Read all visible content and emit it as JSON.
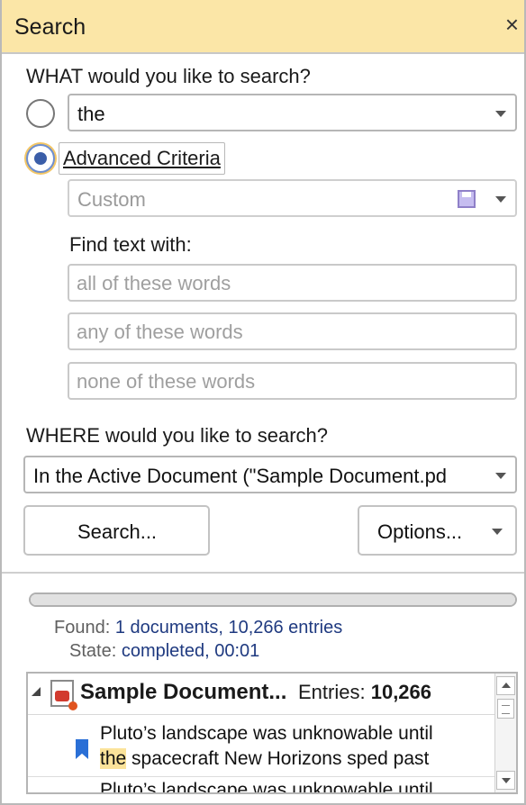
{
  "panel": {
    "title": "Search",
    "close_glyph": "×"
  },
  "what": {
    "label": "WHAT would you like to search?",
    "basic_value": "the",
    "advanced_label": "Advanced Criteria",
    "criteria_value": "Custom",
    "find_text_label": "Find text with:",
    "all_words_placeholder": "all of these words",
    "any_words_placeholder": "any of these words",
    "none_words_placeholder": "none of these words"
  },
  "where": {
    "label": "WHERE would you like to search?",
    "scope_value": "In the Active Document (\"Sample Document.pd"
  },
  "buttons": {
    "search": "Search...",
    "options": "Options..."
  },
  "progress": {
    "fraction": 1.0
  },
  "status": {
    "found_key": "Found:",
    "found_value": "1 documents, 10,266 entries",
    "state_key": "State:",
    "state_value": "completed, 00:01"
  },
  "results": {
    "document_name": "Sample Document...",
    "entries_label": "Entries:",
    "entries_count": "10,266",
    "item": {
      "text_before": "Pluto’s landscape was unknowable until",
      "highlight": "the",
      "text_after": "spacecraft New Horizons sped past"
    },
    "peek_text": "Pluto’s landscape was unknowable until"
  },
  "icons": [
    "close-icon",
    "save-icon",
    "chevron-down-icon",
    "pdf-document-icon",
    "bookmark-icon",
    "expand-collapse-icon",
    "scroll-up-icon",
    "scroll-down-icon"
  ],
  "colors": {
    "title_bar": "#fbe6a7",
    "highlight": "#fbe39a",
    "link_value": "#1f3a80",
    "radio_selected": "#3b5ea8"
  }
}
